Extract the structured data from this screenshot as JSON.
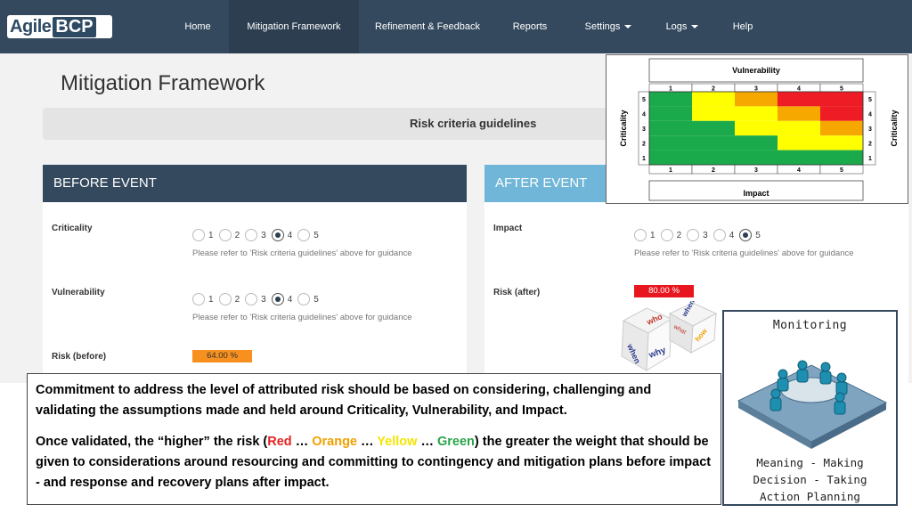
{
  "logo": {
    "part1": "Agile",
    "part2": "BCP"
  },
  "nav": {
    "home": "Home",
    "mitigation": "Mitigation Framework",
    "refinement": "Refinement & Feedback",
    "reports": "Reports",
    "settings": "Settings",
    "logs": "Logs",
    "help": "Help"
  },
  "page": {
    "title": "Mitigation Framework",
    "guidelines": "Risk criteria guidelines"
  },
  "before": {
    "header": "BEFORE EVENT",
    "criticality": {
      "label": "Criticality",
      "options": [
        "1",
        "2",
        "3",
        "4",
        "5"
      ],
      "selected": "4"
    },
    "vulnerability": {
      "label": "Vulnerability",
      "options": [
        "1",
        "2",
        "3",
        "4",
        "5"
      ],
      "selected": "4"
    },
    "hint": "Please refer to 'Risk criteria guidelines' above for guidance",
    "risk_label": "Risk (before)",
    "risk_value": "64.00 %",
    "risk_color": "#f7901e"
  },
  "after": {
    "header": "AFTER EVENT",
    "impact": {
      "label": "Impact",
      "options": [
        "1",
        "2",
        "3",
        "4",
        "5"
      ],
      "selected": "5"
    },
    "hint": "Please refer to 'Risk criteria guidelines' above for guidance",
    "risk_label": "Risk (after)",
    "risk_value": "80.00 %",
    "risk_color": "#e8171f"
  },
  "matrix": {
    "title": "Vulnerability",
    "bottom_label": "Impact",
    "side_label": "Criticality",
    "columns": [
      "1",
      "2",
      "3",
      "4",
      "5"
    ],
    "rows": [
      "5",
      "4",
      "3",
      "2",
      "1"
    ],
    "colors": {
      "green": "#1aaa4b",
      "yellow": "#ffff00",
      "orange": "#f7a800",
      "red": "#ee1c25"
    },
    "cells": [
      [
        "green",
        "yellow",
        "orange",
        "red",
        "red"
      ],
      [
        "green",
        "yellow",
        "yellow",
        "orange",
        "red"
      ],
      [
        "green",
        "green",
        "yellow",
        "yellow",
        "orange"
      ],
      [
        "green",
        "green",
        "green",
        "yellow",
        "yellow"
      ],
      [
        "green",
        "green",
        "green",
        "green",
        "green"
      ]
    ]
  },
  "dice": {
    "words": [
      "who",
      "when",
      "why",
      "what",
      "how"
    ]
  },
  "callout": {
    "para1": "Commitment to address the level of attributed risk should be based on considering, challenging and validating the assumptions made and held around Criticality, Vulnerability, and Impact.",
    "para2_a": "Once validated, the “higher” the risk (",
    "red": "Red",
    "sep1": " … ",
    "orange": "Orange",
    "sep2": " … ",
    "yellow": "Yellow",
    "sep3": " … ",
    "green": "Green",
    "para2_b": ") the greater the weight that should be given to considerations around resourcing and committing to contingency and mitigation plans before impact - and response and recovery plans after impact."
  },
  "monitoring": {
    "title": "Monitoring",
    "line1": "Meaning - Making",
    "line2": "Decision - Taking",
    "line3": "Action Planning"
  }
}
